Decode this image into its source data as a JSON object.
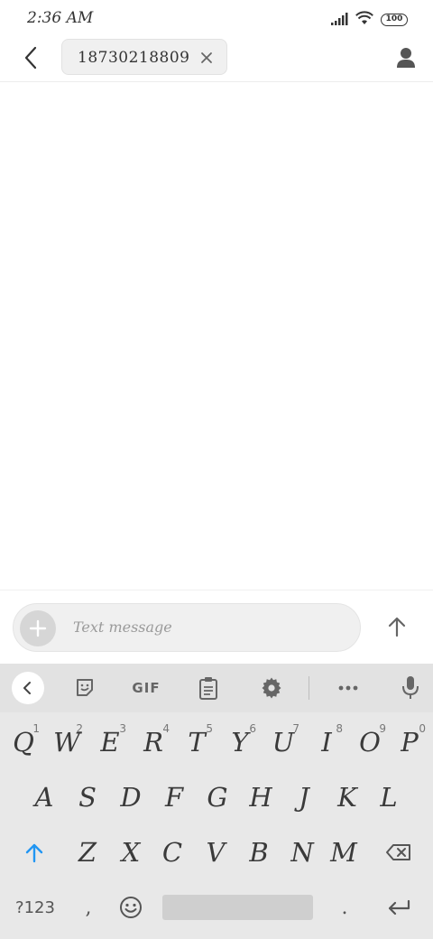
{
  "status_bar": {
    "time": "2:36 AM",
    "battery": "100",
    "icons": [
      "signal-icon",
      "wifi-icon",
      "battery-icon"
    ]
  },
  "header": {
    "back_icon": "back-arrow-icon",
    "recipient": "18730218809",
    "chip_close_icon": "close-icon",
    "contact_icon": "person-icon"
  },
  "composer": {
    "add_icon": "plus-icon",
    "placeholder": "Text message",
    "send_icon": "send-arrow-icon"
  },
  "keyboard": {
    "toolbar": {
      "collapse_icon": "chevron-left-icon",
      "sticker_icon": "sticker-icon",
      "gif_label": "GIF",
      "clipboard_icon": "clipboard-icon",
      "settings_icon": "gear-icon",
      "more_icon": "more-icon",
      "mic_icon": "microphone-icon"
    },
    "row1": [
      {
        "label": "Q",
        "hint": "1"
      },
      {
        "label": "W",
        "hint": "2"
      },
      {
        "label": "E",
        "hint": "3"
      },
      {
        "label": "R",
        "hint": "4"
      },
      {
        "label": "T",
        "hint": "5"
      },
      {
        "label": "Y",
        "hint": "6"
      },
      {
        "label": "U",
        "hint": "7"
      },
      {
        "label": "I",
        "hint": "8"
      },
      {
        "label": "O",
        "hint": "9"
      },
      {
        "label": "P",
        "hint": "0"
      }
    ],
    "row2": [
      "A",
      "S",
      "D",
      "F",
      "G",
      "H",
      "J",
      "K",
      "L"
    ],
    "row3": [
      "Z",
      "X",
      "C",
      "V",
      "B",
      "N",
      "M"
    ],
    "shift_icon": "shift-arrow-icon",
    "backspace_icon": "backspace-icon",
    "symbols_label": "?123",
    "comma_label": ",",
    "emoji_icon": "emoji-icon",
    "period_label": ".",
    "enter_icon": "enter-icon",
    "accent_color": "#2196f3"
  }
}
